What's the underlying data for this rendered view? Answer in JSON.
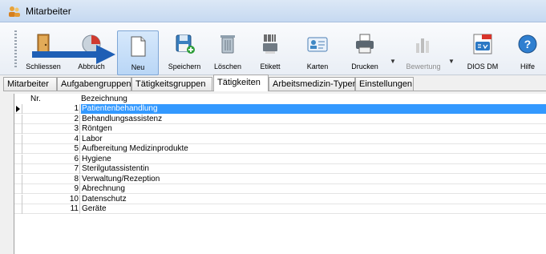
{
  "window": {
    "title": "Mitarbeiter"
  },
  "toolbar": {
    "buttons": [
      {
        "label": "Schliessen",
        "icon": "door-exit-icon"
      },
      {
        "label": "Abbruch",
        "icon": "cancel-icon"
      },
      {
        "label": "Neu",
        "icon": "new-document-icon"
      },
      {
        "label": "Speichern",
        "icon": "save-icon"
      },
      {
        "label": "Löschen",
        "icon": "trash-icon"
      },
      {
        "label": "Etikett",
        "icon": "label-printer-icon"
      },
      {
        "label": "Karten",
        "icon": "contact-card-icon"
      },
      {
        "label": "Drucken",
        "icon": "printer-icon"
      },
      {
        "label": "Bewertung",
        "icon": "chart-icon"
      },
      {
        "label": "DIOS DM",
        "icon": "qm-pdf-icon"
      },
      {
        "label": "Hilfe",
        "icon": "help-icon"
      }
    ]
  },
  "tabs": [
    {
      "label": "Mitarbeiter"
    },
    {
      "label": "Aufgabengruppen"
    },
    {
      "label": "Tätigkeitsgruppen"
    },
    {
      "label": "Tätigkeiten"
    },
    {
      "label": "Arbeitsmedizin-Typen"
    },
    {
      "label": "Einstellungen"
    }
  ],
  "grid": {
    "columns": {
      "nr": "Nr.",
      "bez": "Bezeichnung"
    },
    "rows": [
      {
        "nr": "1",
        "bez": "Patientenbehandlung"
      },
      {
        "nr": "2",
        "bez": "Behandlungsassistenz"
      },
      {
        "nr": "3",
        "bez": "Röntgen"
      },
      {
        "nr": "4",
        "bez": "Labor"
      },
      {
        "nr": "5",
        "bez": "Aufbereitung Medizinprodukte"
      },
      {
        "nr": "6",
        "bez": "Hygiene"
      },
      {
        "nr": "7",
        "bez": "Sterilgutassistentin"
      },
      {
        "nr": "8",
        "bez": "Verwaltung/Rezeption"
      },
      {
        "nr": "9",
        "bez": "Abrechnung"
      },
      {
        "nr": "10",
        "bez": "Datenschutz"
      },
      {
        "nr": "11",
        "bez": "Geräte"
      }
    ],
    "selected_row": 1
  },
  "colors": {
    "selection": "#3399ff",
    "arrow": "#1f5fb5"
  }
}
